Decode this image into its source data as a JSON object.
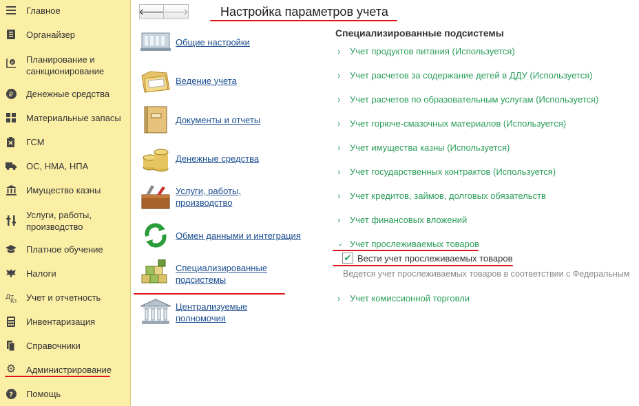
{
  "sidebar": {
    "items": [
      {
        "label": "Главное",
        "icon": "menu-icon"
      },
      {
        "label": "Органайзер",
        "icon": "organizer-icon"
      },
      {
        "label": "Планирование и санкционирование",
        "icon": "planning-icon"
      },
      {
        "label": "Денежные средства",
        "icon": "ruble-icon"
      },
      {
        "label": "Материальные запасы",
        "icon": "grid-icon"
      },
      {
        "label": "ГСМ",
        "icon": "fuel-icon"
      },
      {
        "label": "ОС, НМА, НПА",
        "icon": "truck-icon"
      },
      {
        "label": "Имущество казны",
        "icon": "bank-icon"
      },
      {
        "label": "Услуги, работы, производство",
        "icon": "tools-icon"
      },
      {
        "label": "Платное обучение",
        "icon": "graduation-icon"
      },
      {
        "label": "Налоги",
        "icon": "emblem-icon"
      },
      {
        "label": "Учет и отчетность",
        "icon": "accounting-icon"
      },
      {
        "label": "Инвентаризация",
        "icon": "calculator-icon"
      },
      {
        "label": "Справочники",
        "icon": "book-icon"
      },
      {
        "label": "Администрирование",
        "icon": "gear-icon"
      },
      {
        "label": "Помощь",
        "icon": "help-icon"
      }
    ]
  },
  "header": {
    "back_icon": "arrow-left-icon",
    "forward_icon": "arrow-right-icon",
    "title": "Настройка параметров учета"
  },
  "categories": [
    {
      "label": "Общие настройки",
      "icon": "settings-building-icon"
    },
    {
      "label": "Ведение учета",
      "icon": "folder-icon"
    },
    {
      "label": "Документы и отчеты",
      "icon": "binder-icon"
    },
    {
      "label": "Денежные средства",
      "icon": "coins-icon"
    },
    {
      "label": "Услуги, работы, производство",
      "icon": "toolbox-icon"
    },
    {
      "label": "Обмен данными и интеграция",
      "icon": "sync-icon"
    },
    {
      "label": "Специализированные подсистемы",
      "icon": "cubes-icon"
    },
    {
      "label": "Централизуемые полномочия",
      "icon": "institution-icon"
    }
  ],
  "section": {
    "title": "Специализированные подсистемы",
    "subsystems": [
      {
        "label": "Учет продуктов питания (Используется)",
        "expanded": false
      },
      {
        "label": "Учет расчетов за содержание детей в ДДУ (Используется)",
        "expanded": false
      },
      {
        "label": "Учет расчетов по образовательным услугам (Используется)",
        "expanded": false
      },
      {
        "label": "Учет горюче-смазочных материалов (Используется)",
        "expanded": false
      },
      {
        "label": "Учет имущества казны (Используется)",
        "expanded": false
      },
      {
        "label": "Учет государственных контрактов (Используется)",
        "expanded": false
      },
      {
        "label": "Учет кредитов, займов, долговых обязательств",
        "expanded": false
      },
      {
        "label": "Учет финансовых вложений",
        "expanded": false
      },
      {
        "label": "Учет прослеживаемых товаров",
        "expanded": true
      },
      {
        "label": "Учет комиссионной торговли",
        "expanded": false
      }
    ],
    "traceable": {
      "checkbox_label": "Вести учет прослеживаемых товаров",
      "checked": true,
      "hint": "Ведется учет прослеживаемых товаров в соответствии с Федеральным"
    }
  },
  "colors": {
    "sidebar_bg": "#fbeea5",
    "link": "#1a4d8f",
    "subsystem": "#2a9d5a",
    "highlight": "#e0121a"
  }
}
